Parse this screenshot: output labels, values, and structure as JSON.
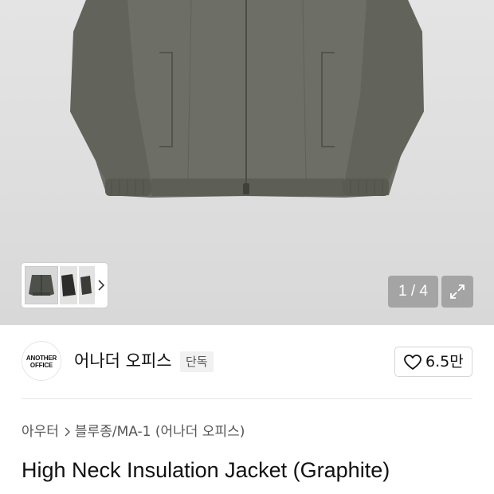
{
  "gallery": {
    "counter": "1 / 4",
    "thumbnails": [
      "thumbnail-front",
      "thumbnail-dark",
      "thumbnail-side"
    ],
    "icons": {
      "next": "chevron-right-icon",
      "expand": "expand-arrows-icon"
    }
  },
  "brand": {
    "logo_line1": "ANOTHER",
    "logo_line2": "OFFICE",
    "name": "어나더 오피스",
    "badge": "단독",
    "like_count": "6.5만",
    "like_icon": "heart-outline-icon"
  },
  "breadcrumb": {
    "category": "아우터",
    "subcategory": "블루종/MA-1 (어나더 오피스)"
  },
  "product": {
    "title": "High Neck Insulation Jacket (Graphite)"
  },
  "colors": {
    "jacket": "#686a62",
    "overlay": "rgba(120,120,120,0.55)",
    "text": "#111111",
    "muted": "#555555"
  }
}
